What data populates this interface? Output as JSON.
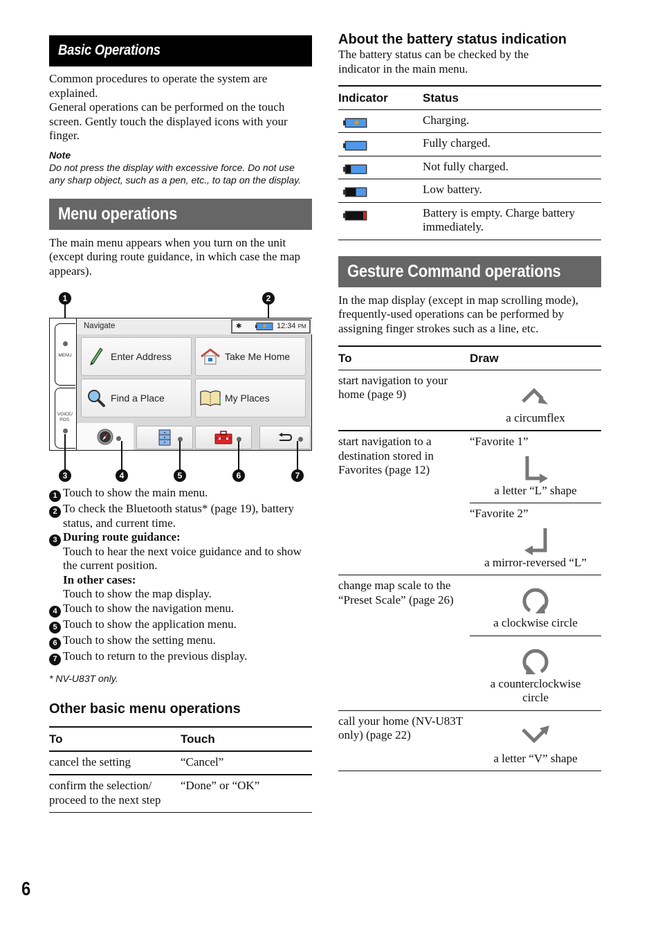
{
  "page_number": "6",
  "basic": {
    "title": "Basic Operations",
    "para1": "Common procedures to operate the system are explained.",
    "para2": "General operations can be performed on the touch screen. Gently touch the displayed icons with your finger.",
    "note_title": "Note",
    "note_text": "Do not press the display with excessive force. Do not use any sharp object, such as a pen, etc., to tap on the display."
  },
  "menu_ops": {
    "title": "Menu operations",
    "intro": "The main menu appears when you turn on the unit (except during route guidance, in which case the map appears).",
    "device": {
      "side_buttons": [
        "MENU",
        "VOICE/\nPOS."
      ],
      "header": "Navigate",
      "status": {
        "bluetooth_icon": "bluetooth-icon",
        "battery_icon": "battery-charging-icon",
        "time": "12:34",
        "ampm": "PM"
      },
      "tiles": [
        {
          "label": "Enter Address",
          "icon": "pencil-icon"
        },
        {
          "label": "Take Me Home",
          "icon": "home-icon"
        },
        {
          "label": "Find a Place",
          "icon": "magnifier-icon"
        },
        {
          "label": "My Places",
          "icon": "book-icon"
        }
      ],
      "tabs": [
        {
          "icon": "compass-icon"
        },
        {
          "icon": "cabinet-icon"
        },
        {
          "icon": "toolbox-icon"
        },
        {
          "icon": "back-arrow-icon"
        }
      ],
      "callouts": [
        "1",
        "2",
        "3",
        "4",
        "5",
        "6",
        "7"
      ]
    },
    "legend": [
      {
        "num": "1",
        "text": "Touch to show the main menu."
      },
      {
        "num": "2",
        "text": "To check the Bluetooth status* (page 19), battery status, and current time."
      },
      {
        "num": "3",
        "bold1": "During route guidance:",
        "text1": "Touch to hear the next voice guidance and to show the current position.",
        "bold2": "In other cases:",
        "text2": "Touch to show the map display."
      },
      {
        "num": "4",
        "text": "Touch to show the navigation menu."
      },
      {
        "num": "5",
        "text": "Touch to show the application menu."
      },
      {
        "num": "6",
        "text": "Touch to show the setting menu."
      },
      {
        "num": "7",
        "text": "Touch to return to the previous display."
      }
    ],
    "footnote": "* NV-U83T only."
  },
  "other_ops": {
    "title": "Other basic menu operations",
    "headers": [
      "To",
      "Touch"
    ],
    "rows": [
      [
        "cancel the setting",
        "“Cancel”"
      ],
      [
        "confirm the selection/ proceed to the next step",
        "“Done” or “OK”"
      ]
    ]
  },
  "battery": {
    "title": "About the battery status indication",
    "intro": "The battery status can be checked by the indicator in the main menu.",
    "headers": [
      "Indicator",
      "Status"
    ],
    "rows": [
      {
        "icon": "battery-charging-icon",
        "level": 1.0,
        "charging": true,
        "status": "Charging."
      },
      {
        "icon": "battery-full-icon",
        "level": 1.0,
        "charging": false,
        "status": "Fully charged."
      },
      {
        "icon": "battery-partial-icon",
        "level": 0.75,
        "charging": false,
        "status": "Not fully charged."
      },
      {
        "icon": "battery-low-icon",
        "level": 0.5,
        "charging": false,
        "status": "Low battery."
      },
      {
        "icon": "battery-empty-icon",
        "level": 0.0,
        "charging": false,
        "status": "Battery is empty. Charge battery immediately."
      }
    ],
    "colors": {
      "blue": "#4f97e8",
      "red": "#e02020",
      "bolt": "#e0a020"
    }
  },
  "gesture": {
    "title": "Gesture Command operations",
    "intro": "In the map display (except in map scrolling mode), frequently-used operations can be performed by assigning finger strokes such as a line, etc.",
    "headers": [
      "To",
      "Draw"
    ],
    "rows": [
      {
        "to": "start navigation to your home (page 9)",
        "draws": [
          {
            "label": "",
            "icon": "circumflex-gesture-icon",
            "caption": "a circumflex"
          }
        ]
      },
      {
        "to": "start navigation to a destination stored in Favorites (page 12)",
        "draws": [
          {
            "label": "“Favorite 1”",
            "icon": "l-shape-gesture-icon",
            "caption": "a letter “L” shape"
          },
          {
            "label": "“Favorite 2”",
            "icon": "reversed-l-gesture-icon",
            "caption": "a mirror-reversed “L”"
          }
        ]
      },
      {
        "to": "change map scale to the “Preset Scale” (page 26)",
        "draws": [
          {
            "label": "",
            "icon": "clockwise-circle-gesture-icon",
            "caption": "a clockwise circle"
          },
          {
            "label": "",
            "icon": "counterclockwise-circle-gesture-icon",
            "caption": "a counterclockwise circle"
          }
        ]
      },
      {
        "to": "call your home (NV-U83T only) (page 22)",
        "draws": [
          {
            "label": "",
            "icon": "v-shape-gesture-icon",
            "caption": "a letter “V” shape"
          }
        ]
      }
    ],
    "gesture_color": "#777777"
  }
}
